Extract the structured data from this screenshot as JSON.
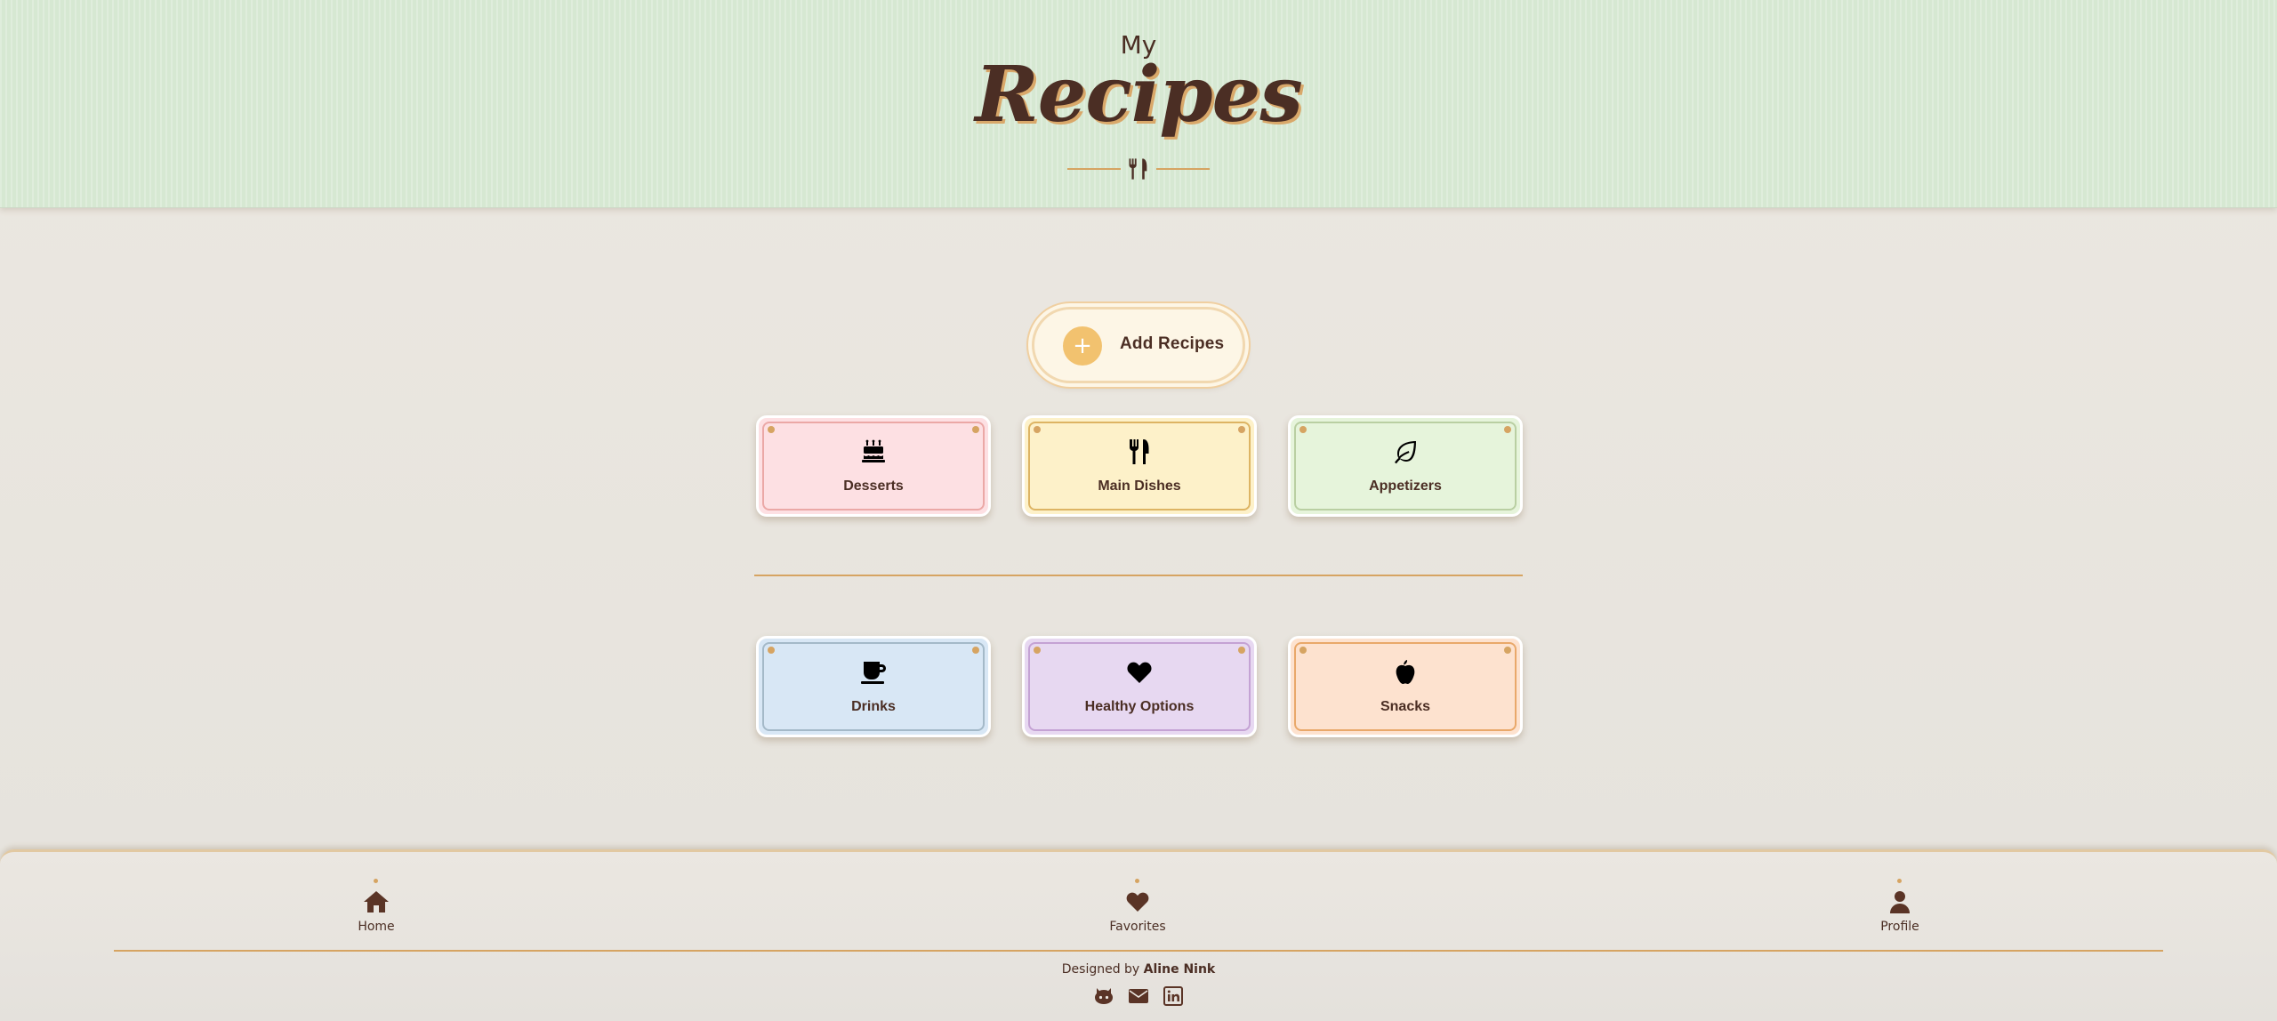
{
  "header": {
    "eyebrow": "My",
    "title": "Recipes",
    "divider_icon": "utensils-icon"
  },
  "add_button": {
    "icon": "+",
    "label": "Add Recipes"
  },
  "categories": [
    {
      "label": "Desserts",
      "icon": "birthday-cake-icon",
      "color": "#fde0e3"
    },
    {
      "label": "Main Dishes",
      "icon": "utensils-icon",
      "color": "#fdf1c9"
    },
    {
      "label": "Appetizers",
      "icon": "leaf-icon",
      "color": "#e6f4db"
    },
    {
      "label": "Drinks",
      "icon": "mug-icon",
      "color": "#d8e7f5"
    },
    {
      "label": "Healthy Options",
      "icon": "heart-icon",
      "color": "#e7d8f1"
    },
    {
      "label": "Snacks",
      "icon": "apple-icon",
      "color": "#fde2cf"
    }
  ],
  "nav": {
    "home": "Home",
    "favorites": "Favorites",
    "profile": "Profile"
  },
  "footer": {
    "credit_prefix": "Designed by",
    "credit_name": "Aline Nink",
    "social": [
      "github-icon",
      "mail-icon",
      "linkedin-icon"
    ]
  },
  "colors": {
    "accent": "#d6a462",
    "text": "#4b2e24",
    "header_bg": "#d6e8d2",
    "page_bg": "#ece8e1",
    "button_bg": "#fdf6e6",
    "plus_bg": "#f2c26f"
  }
}
